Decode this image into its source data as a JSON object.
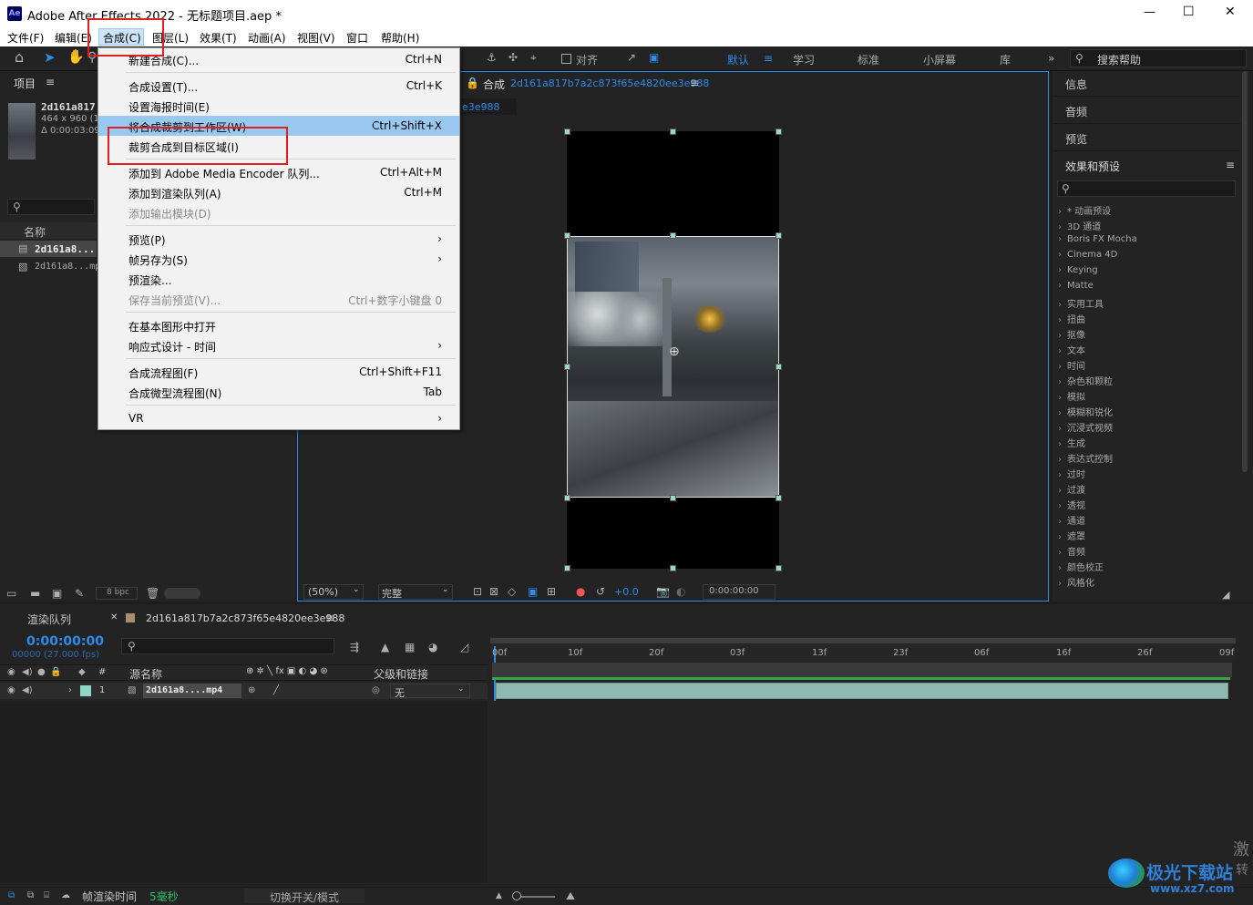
{
  "window": {
    "app_icon": "Ae",
    "title": "Adobe After Effects 2022 - 无标题项目.aep *",
    "minimize": "—",
    "maximize": "☐",
    "close": "✕"
  },
  "menubar": [
    "文件(F)",
    "编辑(E)",
    "合成(C)",
    "图层(L)",
    "效果(T)",
    "动画(A)",
    "视图(V)",
    "窗口",
    "帮助(H)"
  ],
  "toolbar": {
    "align_label": "对齐",
    "workspaces": [
      "默认",
      "学习",
      "标准",
      "小屏幕",
      "库"
    ],
    "overflow": "»",
    "search_help": "搜索帮助"
  },
  "project_panel": {
    "tab": "项目",
    "item_name": "2d161a817",
    "item_dims": "464 x 960 (1.",
    "item_dur": "Δ 0:00:03:09",
    "col_name": "名称",
    "rows": [
      "2d161a8...",
      "2d161a8...mp"
    ],
    "bpc": "8 bpc"
  },
  "comp_panel": {
    "tab_prefix": "合成",
    "tab_name": "2d161a817b7a2c873f65e4820ee3e988",
    "breadcrumb": "e3e988",
    "zoom": "(50%)",
    "quality": "完整",
    "exposure": "+0.0",
    "timecode": "0:00:00:00"
  },
  "right_panels": {
    "info": "信息",
    "audio": "音频",
    "preview": "预览",
    "effects": "效果和预设",
    "effects_list": [
      "* 动画预设",
      "3D 通道",
      "Boris FX Mocha",
      "Cinema 4D",
      "Keying",
      "Matte",
      "实用工具",
      "扭曲",
      "抠像",
      "文本",
      "时间",
      "杂色和颗粒",
      "模拟",
      "模糊和锐化",
      "沉浸式视频",
      "生成",
      "表达式控制",
      "过时",
      "过渡",
      "透视",
      "通道",
      "遮罩",
      "音频",
      "颜色校正",
      "风格化"
    ]
  },
  "compose_menu": {
    "items": [
      {
        "label": "新建合成(C)...",
        "shortcut": "Ctrl+N"
      },
      {
        "label": "合成设置(T)...",
        "shortcut": "Ctrl+K"
      },
      {
        "label": "设置海报时间(E)",
        "shortcut": ""
      },
      {
        "label": "将合成裁剪到工作区(W)",
        "shortcut": "Ctrl+Shift+X"
      },
      {
        "label": "裁剪合成到目标区域(I)",
        "shortcut": ""
      },
      {
        "label": "添加到 Adobe Media Encoder 队列...",
        "shortcut": "Ctrl+Alt+M"
      },
      {
        "label": "添加到渲染队列(A)",
        "shortcut": "Ctrl+M"
      },
      {
        "label": "添加输出模块(D)",
        "shortcut": ""
      },
      {
        "label": "预览(P)",
        "shortcut": "›"
      },
      {
        "label": "帧另存为(S)",
        "shortcut": "›"
      },
      {
        "label": "预渲染...",
        "shortcut": ""
      },
      {
        "label": "保存当前预览(V)...",
        "shortcut": "Ctrl+数字小键盘 0"
      },
      {
        "label": "在基本图形中打开",
        "shortcut": ""
      },
      {
        "label": "响应式设计 - 时间",
        "shortcut": "›"
      },
      {
        "label": "合成流程图(F)",
        "shortcut": "Ctrl+Shift+F11"
      },
      {
        "label": "合成微型流程图(N)",
        "shortcut": "Tab"
      },
      {
        "label": "VR",
        "shortcut": "›"
      }
    ]
  },
  "timeline": {
    "render_queue_tab": "渲染队列",
    "comp_tab": "2d161a817b7a2c873f65e4820ee3e988",
    "timecode": "0:00:00:00",
    "fps": "00000 (27.000 fps)",
    "col_hash": "#",
    "col_source": "源名称",
    "col_parent": "父级和链接",
    "layer_num": "1",
    "layer_name": "2d161a8....mp4",
    "parent_value": "无",
    "ruler": [
      "00f",
      "10f",
      "20f",
      "03f",
      "13f",
      "23f",
      "06f",
      "16f",
      "26f",
      "09f"
    ],
    "footer_label": "帧渲染时间",
    "footer_value": "5毫秒",
    "toggle_mode": "切换开关/模式"
  },
  "watermark": {
    "brand": "极光下载站",
    "url": "www.xz7.com",
    "corner_text": [
      "激",
      "转"
    ]
  },
  "colors": {
    "accent": "#2d8ceb",
    "highlight": "#99c8f0",
    "layer_bar": "#8fb8b0",
    "red_box": "#e02020",
    "label_teal": "#8fd6c9"
  }
}
